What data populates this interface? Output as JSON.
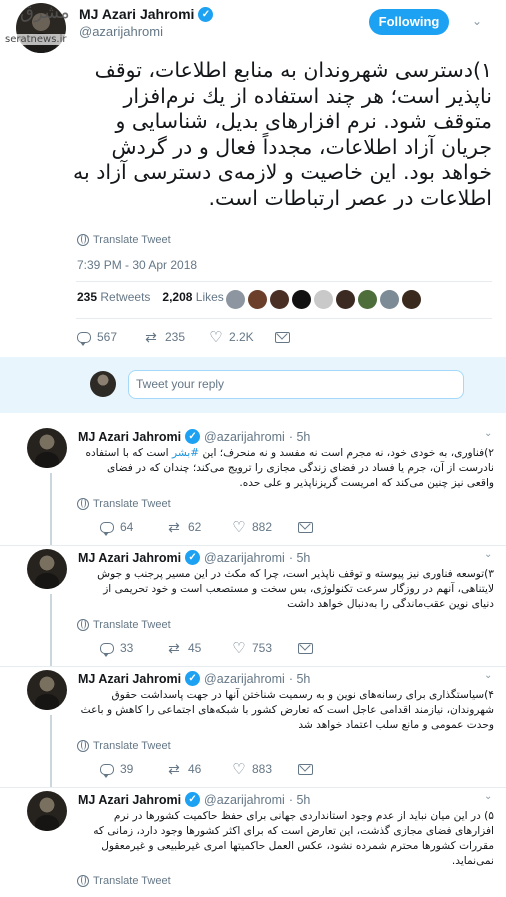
{
  "watermark": {
    "logo": "مشرق",
    "site": "seratnews.ir"
  },
  "main_tweet": {
    "name": "MJ Azari Jahromi",
    "handle": "@azarijahromi",
    "follow_label": "Following",
    "text": "۱)دسترسی شهروندان به منابع اطلاعات، توقف ناپذیر است؛ هر چند استفاده از یك نرم‌افزار متوقف شود. نرم افزارهای بدیل، شناسایی و جریان آزاد اطلاعات، مجدداً فعال و در گردش خواهد بود. این خاصیت و لازمه‌ی دسترسی آزاد به اطلاعات در عصر ارتباطات است.",
    "translate_label": "Translate Tweet",
    "timestamp": "7:39 PM - 30 Apr 2018",
    "retweets_count": "235",
    "retweets_label": "Retweets",
    "likes_count": "2,208",
    "likes_label": "Likes",
    "liker_colors": [
      "#8d96a0",
      "#6b3f2a",
      "#4a2f25",
      "#111111",
      "#c9c9c9",
      "#3b2a22",
      "#4d6d3a",
      "#7c8b95",
      "#3a2a1e"
    ],
    "actions": {
      "replies": "567",
      "retweets": "235",
      "likes": "2.2K"
    }
  },
  "reply_box": {
    "placeholder": "Tweet your reply"
  },
  "replies": [
    {
      "name": "MJ Azari Jahromi",
      "handle": "@azarijahromi",
      "time": "· 5h",
      "text_before_hash": "۲)فناوری، به خودی خود، نه مجرم است نه مفسد و نه منحرف؛ این ",
      "hashtag": "#بشر",
      "text_after_hash": " است كه با استفاده نادرست از آن، جرم یا فساد در فضای زندگی مجازی را ترویج می‌كند؛ چندان كه در فضای واقعی نیز چنین می‌كند كه امریست گریزناپذیر و علی حده.",
      "translate_label": "Translate Tweet",
      "actions": {
        "replies": "64",
        "retweets": "62",
        "likes": "882"
      }
    },
    {
      "name": "MJ Azari Jahromi",
      "handle": "@azarijahromi",
      "time": "· 5h",
      "text": "۳)توسعه فناوری نیز پیوسته و توقف ناپذیر است، چرا كه مكث در این مسیر پرجنب و جوش لایتناهی، آنهم در روزگار سرعت تكنولوژی، بس سخت و مستصعب است و خود تحریمی از دنیای نوین عقب‌ماندگی را به‌دنبال خواهد داشت",
      "translate_label": "Translate Tweet",
      "actions": {
        "replies": "33",
        "retweets": "45",
        "likes": "753"
      }
    },
    {
      "name": "MJ Azari Jahromi",
      "handle": "@azarijahromi",
      "time": "· 5h",
      "text": "۴)سیاستگذاری برای رسانه‌های نوین و به رسمیت شناختن آنها در جهت پاسداشت حقوق شهروندان، نیازمند اقدامی عاجل است كه تعارض كشور با شبكه‌های اجتماعی را كاهش و باعث وحدت عمومی و مانع سلب اعتماد خواهد شد",
      "translate_label": "Translate Tweet",
      "actions": {
        "replies": "39",
        "retweets": "46",
        "likes": "883"
      }
    },
    {
      "name": "MJ Azari Jahromi",
      "handle": "@azarijahromi",
      "time": "· 5h",
      "text": "۵) در این میان نباید از عدم وجود استانداردی جهانی برای حفظ حاكمیت كشورها در نرم افزارهای فضای مجازی گذشت، این تعارض است كه برای اكثر كشورها وجود دارد، زمانی كه مقررات كشورها محترم شمرده نشود، عكس العمل حاكمیتها امری غیرطبیعی و غیرمعقول نمی‌نماید.",
      "translate_label": "Translate Tweet"
    }
  ]
}
